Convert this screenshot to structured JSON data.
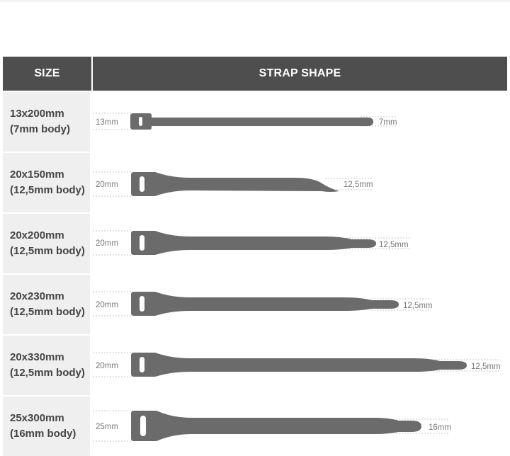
{
  "header": {
    "size_label": "SIZE",
    "shape_label": "STRAP SHAPE"
  },
  "colors": {
    "header_bg": "#4e4e4e",
    "size_cell_bg": "#efefef",
    "strap": "#6b6b6b",
    "text": "#444444"
  },
  "rows": [
    {
      "size": "13x200mm",
      "body": "(7mm body)",
      "head_width": "13mm",
      "tail_width": "7mm"
    },
    {
      "size": "20x150mm",
      "body": "(12,5mm body)",
      "head_width": "20mm",
      "tail_width": "12,5mm"
    },
    {
      "size": "20x200mm",
      "body": "(12,5mm body)",
      "head_width": "20mm",
      "tail_width": "12,5mm"
    },
    {
      "size": "20x230mm",
      "body": "(12,5mm body)",
      "head_width": "20mm",
      "tail_width": "12,5mm"
    },
    {
      "size": "20x330mm",
      "body": "(12,5mm body)",
      "head_width": "20mm",
      "tail_width": "12,5mm"
    },
    {
      "size": "25x300mm",
      "body": "(16mm body)",
      "head_width": "25mm",
      "tail_width": "16mm"
    }
  ]
}
